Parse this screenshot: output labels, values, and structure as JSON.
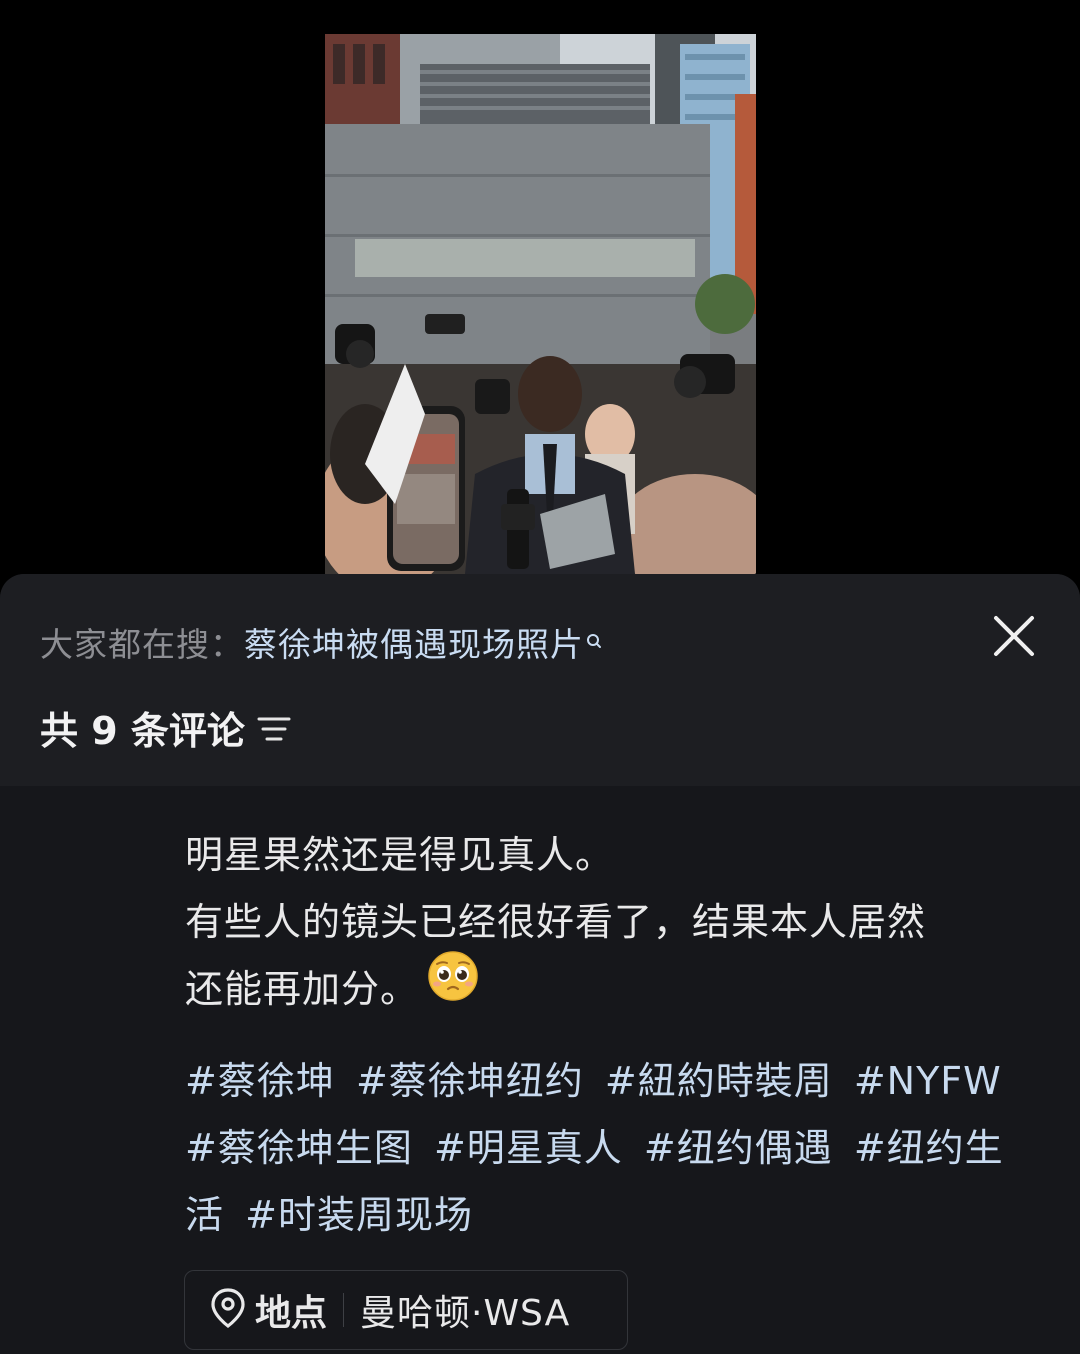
{
  "search_suggestion": {
    "prefix": "大家都在搜：",
    "query": "蔡徐坤被偶遇现场照片"
  },
  "comments_header": {
    "count_text": "共 9 条评论"
  },
  "post": {
    "text_lines": [
      "明星果然还是得见真人。",
      "有些人的镜头已经很好看了，结果本人居然",
      "还能再加分。"
    ],
    "emoji": "pleading-face-emoji",
    "hashtags": [
      "#蔡徐坤",
      "#蔡徐坤纽约",
      "#紐約時裝周",
      "#NYFW",
      "#蔡徐坤生图",
      "#明星真人",
      "#纽约偶遇",
      "#纽约生活",
      "#时装周现场"
    ]
  },
  "location": {
    "label": "地点",
    "value": "曼哈顿·WSA"
  },
  "colors": {
    "sheet_bg": "#16171b",
    "header_bg": "#1d1e22",
    "link_blue": "#c8daef",
    "muted_text": "#8d8e93"
  }
}
